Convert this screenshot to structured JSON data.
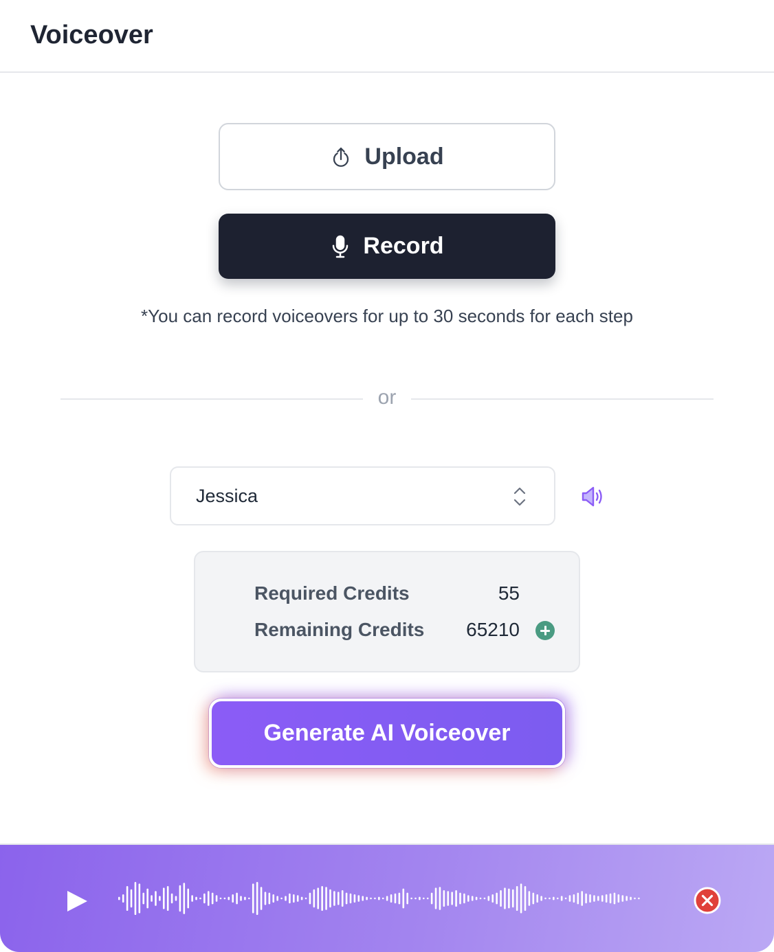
{
  "header": {
    "title": "Voiceover"
  },
  "actions": {
    "upload_label": "Upload",
    "record_label": "Record",
    "note": "*You can record voiceovers for up to 30 seconds for each step",
    "divider_text": "or"
  },
  "voice": {
    "selected": "Jessica",
    "icons": {
      "selector": "chevron-up-down-icon",
      "preview": "speaker-icon"
    }
  },
  "credits": {
    "required_label": "Required Credits",
    "required_value": "55",
    "remaining_label": "Remaining Credits",
    "remaining_value": "65210"
  },
  "generate": {
    "label": "Generate AI Voiceover"
  },
  "player": {
    "icons": {
      "play": "play-icon",
      "close": "close-circle-icon"
    }
  },
  "colors": {
    "accent": "#8b5cf6",
    "dark_button": "#1d2130",
    "credit_add": "#4a9b82",
    "close": "#e0413a"
  }
}
